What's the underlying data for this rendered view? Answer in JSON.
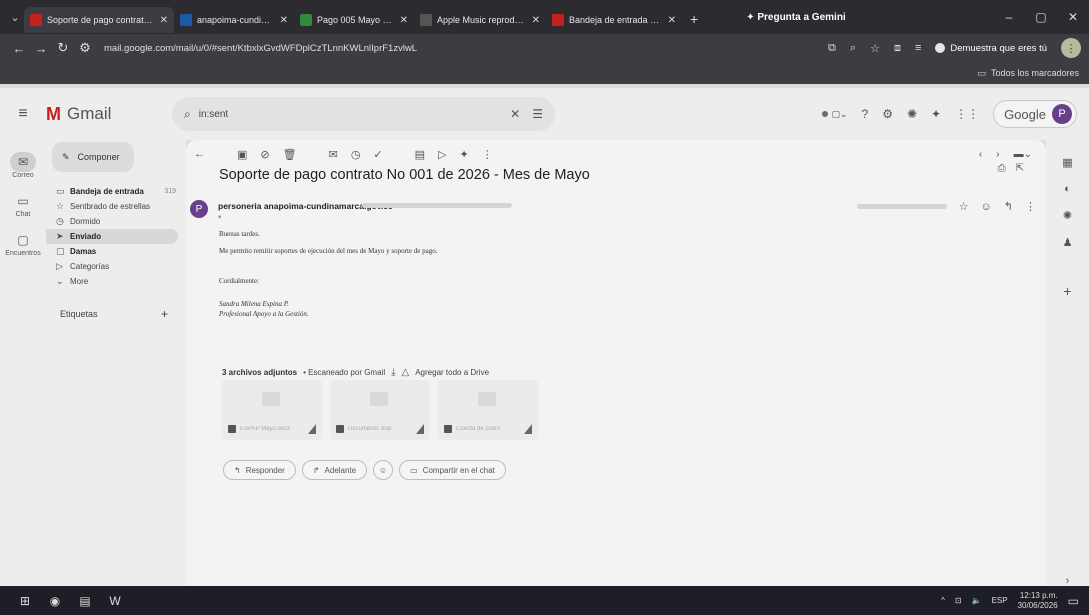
{
  "browser": {
    "tabs": [
      {
        "label": "Soporte de pago contrato No",
        "color": "#c5221f",
        "active": true
      },
      {
        "label": "anapoima-cundinamarca.gov",
        "color": "#1e5aa8",
        "active": false
      },
      {
        "label": "Pago 005 Mayo - CPS 002/2",
        "color": "#2f8a3b",
        "active": false
      },
      {
        "label": "Apple Music reproductor",
        "color": "#555555",
        "active": false
      },
      {
        "label": "Bandeja de entrada Sandra",
        "color": "#c5221f",
        "active": false
      }
    ],
    "new_tab": "+",
    "gemini_label": "✦ Pregunta a Gemini",
    "url": "mail.google.com/mail/u/0/#sent/KtbxlxGvdWFDplCzTLnnKWLnlIprF1zvlwL",
    "profile_label": "Demuestra que eres tú",
    "bookmarks_label": "Todos los marcadores"
  },
  "gmail": {
    "logo_text": "Gmail",
    "search_value": "in:sent",
    "avatar_letter": "P",
    "google_label": "Google"
  },
  "rail": [
    {
      "label": "Correo",
      "icon": "mail-icon"
    },
    {
      "label": "Chat",
      "icon": "chat-icon"
    },
    {
      "label": "Encuentros",
      "icon": "meet-icon"
    }
  ],
  "sidebar": {
    "compose_label": "Componer",
    "items": [
      {
        "label": "Bandeja de entrada",
        "count": "319",
        "bold": true,
        "glyph": "▭"
      },
      {
        "label": "Sentbrado de estrellas",
        "count": "",
        "bold": false,
        "glyph": "☆"
      },
      {
        "label": "Dormido",
        "count": "",
        "bold": false,
        "glyph": "◷"
      },
      {
        "label": "Enviado",
        "count": "",
        "bold": true,
        "glyph": "➤"
      },
      {
        "label": "Damas",
        "count": "",
        "bold": true,
        "glyph": "▢"
      },
      {
        "label": "Categorías",
        "count": "",
        "bold": false,
        "glyph": "▷"
      },
      {
        "label": "More",
        "count": "",
        "bold": false,
        "glyph": "⌄"
      }
    ],
    "labels_heading": "Etiquetas"
  },
  "email": {
    "subject": "Soporte de pago contrato No 001 de 2026 - Mes de Mayo",
    "sender": "personeria anapoima-cundinamarca.gov.co",
    "greeting": "Buenas tardes.",
    "body": "Me permito remitir soportes de ejecución del mes de Mayo y soporte de pago.",
    "closing": "Cordialmente:",
    "sig_name": "Sandra Milena Espina P.",
    "sig_title": "Profesional Apoyo a la Gestión.",
    "attach_count": "3 archivos adjuntos",
    "attach_scan": "• Escaneado por Gmail",
    "attach_drive": "Agregar todo a Drive",
    "attachments": [
      "ESPAP Mayo.docx",
      "Documento Sop.",
      "Cuenta de cobro"
    ],
    "reply_label": "Responder",
    "forward_label": "Adelante",
    "share_label": "Compartir en el chat"
  },
  "taskbar": {
    "lang": "ESP",
    "time": "12:13 p.m.",
    "date": "30/06/2026"
  }
}
